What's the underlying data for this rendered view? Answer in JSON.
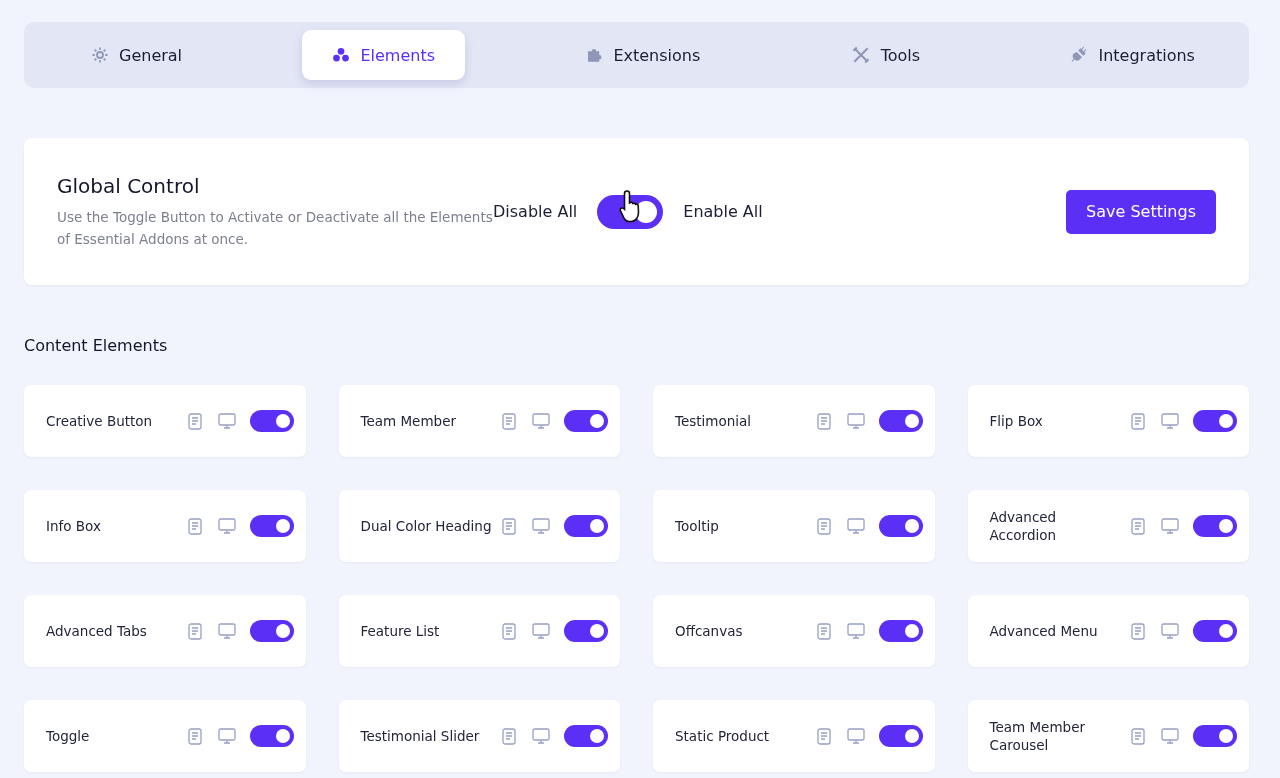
{
  "tabs": [
    {
      "label": "General",
      "selected": false
    },
    {
      "label": "Elements",
      "selected": true
    },
    {
      "label": "Extensions",
      "selected": false
    },
    {
      "label": "Tools",
      "selected": false
    },
    {
      "label": "Integrations",
      "selected": false
    }
  ],
  "global_control": {
    "title": "Global Control",
    "description": "Use the Toggle Button to Activate or Deactivate all the Elements of Essential Addons at once.",
    "disable_label": "Disable All",
    "enable_label": "Enable All",
    "on": true,
    "save_button": "Save Settings"
  },
  "section_title": "Content Elements",
  "elements": [
    {
      "name": "Creative Button",
      "on": true
    },
    {
      "name": "Team Member",
      "on": true
    },
    {
      "name": "Testimonial",
      "on": true
    },
    {
      "name": "Flip Box",
      "on": true
    },
    {
      "name": "Info Box",
      "on": true
    },
    {
      "name": "Dual Color Heading",
      "on": true
    },
    {
      "name": "Tooltip",
      "on": true
    },
    {
      "name": "Advanced Accordion",
      "on": true
    },
    {
      "name": "Advanced Tabs",
      "on": true
    },
    {
      "name": "Feature List",
      "on": true
    },
    {
      "name": "Offcanvas",
      "on": true
    },
    {
      "name": "Advanced Menu",
      "on": true
    },
    {
      "name": "Toggle",
      "on": true
    },
    {
      "name": "Testimonial Slider",
      "on": true
    },
    {
      "name": "Static Product",
      "on": true
    },
    {
      "name": "Team Member Carousel",
      "on": true
    }
  ]
}
